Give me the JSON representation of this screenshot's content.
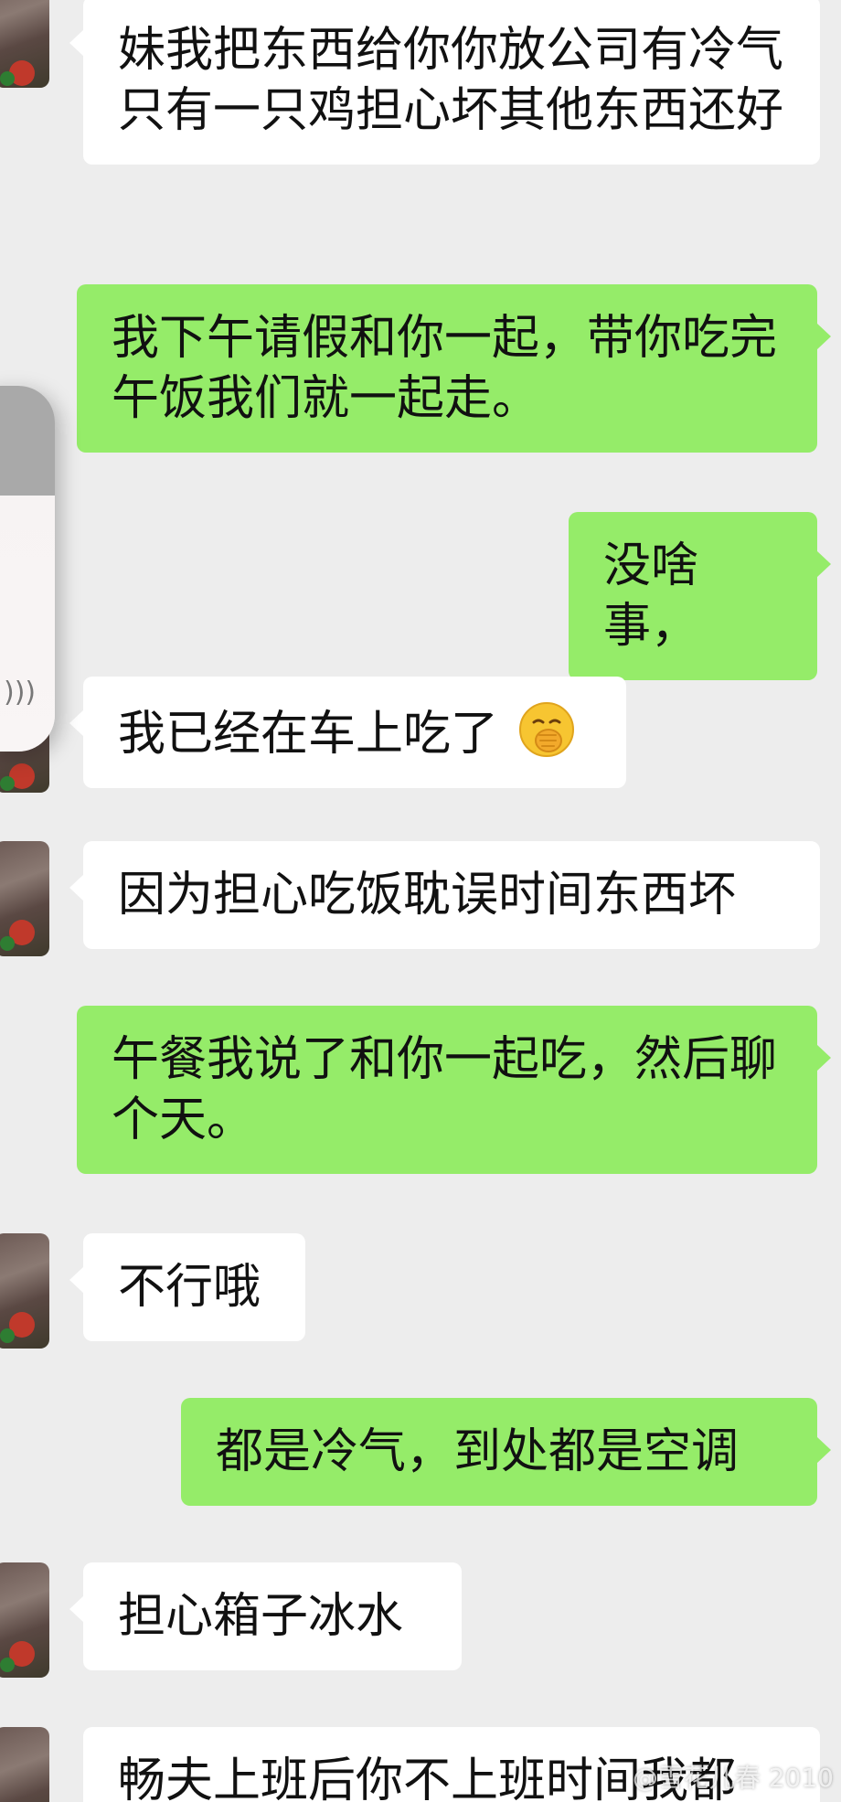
{
  "messages": [
    {
      "side": "in",
      "text": "妹我把东西给你你放公司有冷气只有一只鸡担心坏其他东西还好"
    },
    {
      "side": "out",
      "text": "我下午请假和你一起，带你吃完午饭我们就一起走。"
    },
    {
      "side": "out",
      "text": "没啥事，"
    },
    {
      "side": "in",
      "text": "我已经在车上吃了",
      "emoji": "face-with-hand-over-mouth"
    },
    {
      "side": "in",
      "text": "因为担心吃饭耽误时间东西坏"
    },
    {
      "side": "out",
      "text": "午餐我说了和你一起吃，然后聊个天。"
    },
    {
      "side": "in",
      "text": "不行哦"
    },
    {
      "side": "out",
      "text": "都是冷气，到处都是空调"
    },
    {
      "side": "in",
      "text": "担心箱子冰水"
    },
    {
      "side": "in",
      "text": "畅夫上班后你不上班时间我都"
    }
  ],
  "colors": {
    "background": "#ededed",
    "incoming_bubble": "#ffffff",
    "outgoing_bubble": "#95ec69"
  },
  "watermark": "@雪花儿春 2010"
}
